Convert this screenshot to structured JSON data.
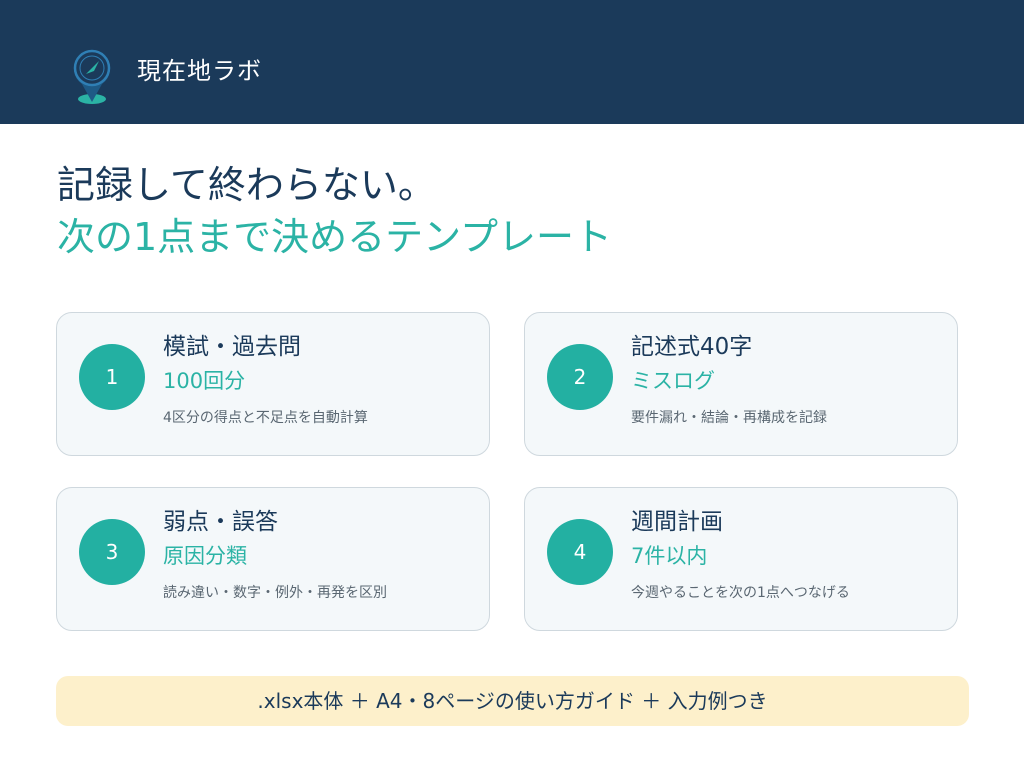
{
  "brand": {
    "name": "現在地ラボ",
    "logo_icon": "location-compass-icon"
  },
  "headline": {
    "line1": "記録して終わらない。",
    "line2": "次の1点まで決めるテンプレート"
  },
  "cards": [
    {
      "number": "1",
      "title": "模試・過去問",
      "subtitle": "100回分",
      "description": "4区分の得点と不足点を自動計算"
    },
    {
      "number": "2",
      "title": "記述式40字",
      "subtitle": "ミスログ",
      "description": "要件漏れ・結論・再構成を記録"
    },
    {
      "number": "3",
      "title": "弱点・誤答",
      "subtitle": "原因分類",
      "description": "読み違い・数字・例外・再発を区別"
    },
    {
      "number": "4",
      "title": "週間計画",
      "subtitle": "7件以内",
      "description": "今週やることを次の1点へつなげる"
    }
  ],
  "banner": {
    "text": ".xlsx本体 ＋ A4・8ページの使い方ガイド ＋ 入力例つき"
  },
  "colors": {
    "navy": "#1b3a5a",
    "teal": "#2bb3a5",
    "card_bg": "#f4f8fa",
    "banner_bg": "#fdf0cb"
  }
}
